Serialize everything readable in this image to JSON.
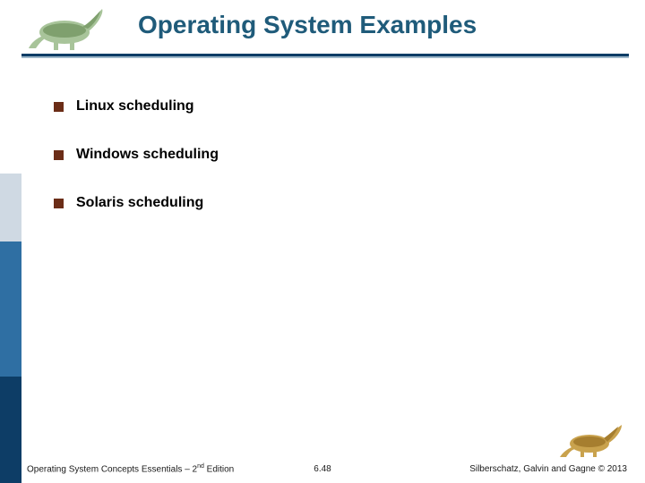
{
  "header": {
    "title": "Operating System Examples"
  },
  "bullets": {
    "item1": "Linux scheduling",
    "item2": "Windows scheduling",
    "item3": "Solaris scheduling"
  },
  "footer": {
    "left_prefix": "Operating System Concepts Essentials – 2",
    "left_sup": "nd",
    "left_suffix": " Edition",
    "center": "6.48",
    "right": "Silberschatz, Galvin and Gagne © 2013"
  }
}
